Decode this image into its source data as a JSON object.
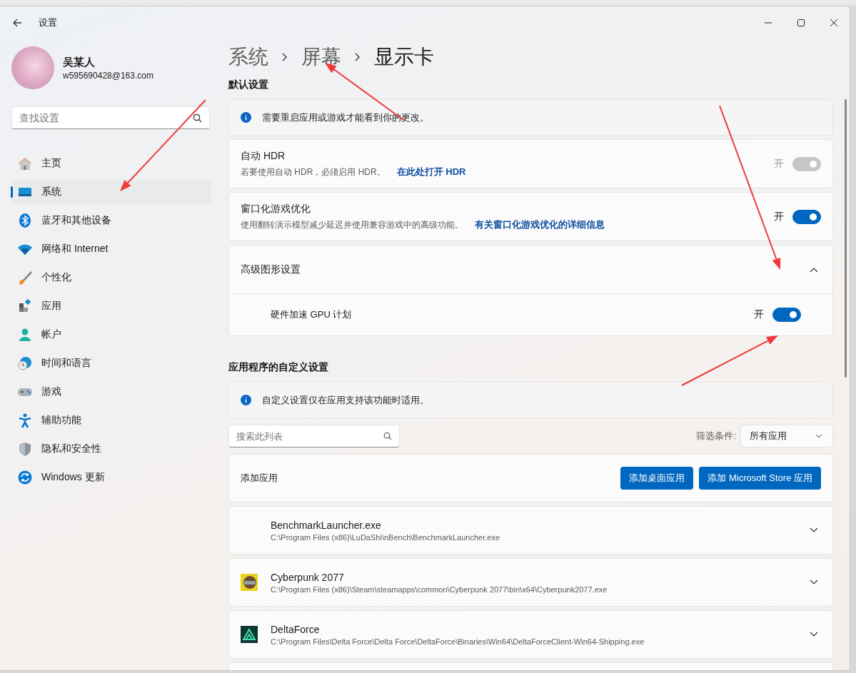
{
  "window": {
    "title": "设置"
  },
  "user": {
    "name": "吴某人",
    "email": "w595690428@163.com"
  },
  "search": {
    "placeholder": "查找设置"
  },
  "nav": [
    {
      "label": "主页",
      "kind": "home",
      "selected": false
    },
    {
      "label": "系统",
      "kind": "system",
      "selected": true
    },
    {
      "label": "蓝牙和其他设备",
      "kind": "bluetooth",
      "selected": false
    },
    {
      "label": "网络和 Internet",
      "kind": "wifi",
      "selected": false
    },
    {
      "label": "个性化",
      "kind": "brush",
      "selected": false
    },
    {
      "label": "应用",
      "kind": "apps",
      "selected": false
    },
    {
      "label": "帐户",
      "kind": "account",
      "selected": false
    },
    {
      "label": "时间和语言",
      "kind": "clock",
      "selected": false
    },
    {
      "label": "游戏",
      "kind": "gamepad",
      "selected": false
    },
    {
      "label": "辅助功能",
      "kind": "accessibility",
      "selected": false
    },
    {
      "label": "隐私和安全性",
      "kind": "shield",
      "selected": false
    },
    {
      "label": "Windows 更新",
      "kind": "update",
      "selected": false
    }
  ],
  "breadcrumb": [
    "系统",
    "屏幕",
    "显示卡"
  ],
  "default_section": {
    "heading": "默认设置",
    "notice": "需要重启应用或游戏才能看到你的更改。",
    "settings": [
      {
        "title": "自动 HDR",
        "description": "若要使用自动 HDR，必须启用 HDR。",
        "link": "在此处打开 HDR",
        "state_label": "开",
        "on": true,
        "disabled": true
      },
      {
        "title": "窗口化游戏优化",
        "description": "使用翻转演示模型减少延迟并使用兼容游戏中的高级功能。",
        "link": "有关窗口化游戏优化的详细信息",
        "state_label": "开",
        "on": true,
        "disabled": false
      }
    ],
    "advanced": {
      "title": "高级图形设置",
      "expanded": true,
      "option": {
        "label": "硬件加速 GPU 计划",
        "state_label": "开",
        "on": true
      }
    }
  },
  "app_section": {
    "heading": "应用程序的自定义设置",
    "notice": "自定义设置仅在应用支持该功能时适用。",
    "search_placeholder": "搜索此列表",
    "filter_label": "筛选条件:",
    "filter_value": "所有应用",
    "add_label": "添加应用",
    "buttons": [
      "添加桌面应用",
      "添加 Microsoft Store 应用"
    ],
    "apps": [
      {
        "name": "BenchmarkLauncher.exe",
        "path": "C:\\Program Files (x86)\\LuDaShi\\nBench\\BenchmarkLauncher.exe",
        "kind": "plain"
      },
      {
        "name": "Cyberpunk 2077",
        "path": "C:\\Program Files (x86)\\Steam\\steamapps\\common\\Cyberpunk 2077\\bin\\x64\\Cyberpunk2077.exe",
        "kind": "cyberpunk"
      },
      {
        "name": "DeltaForce",
        "path": "C:\\Program Files\\Delta Force\\Delta Force\\DeltaForce\\Binaries\\Win64\\DeltaForceClient-Win64-Shipping.exe",
        "kind": "delta"
      }
    ]
  }
}
